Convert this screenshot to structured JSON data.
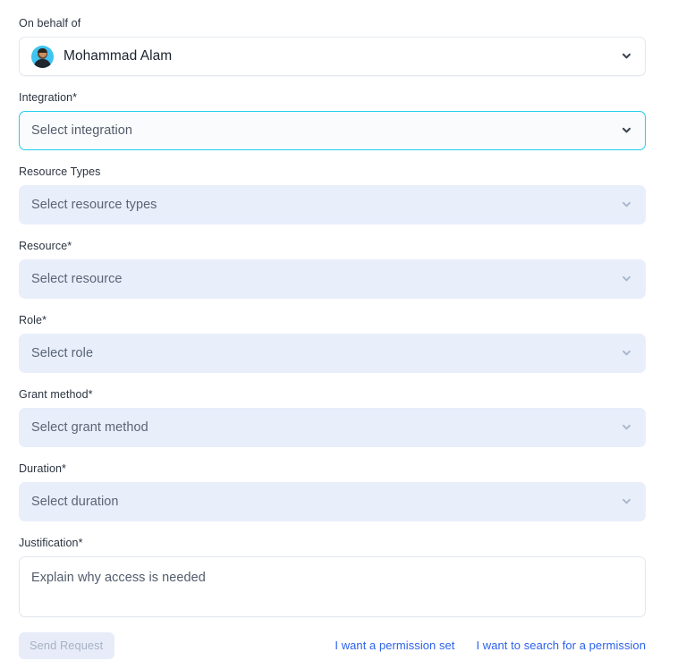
{
  "form": {
    "fields": [
      {
        "key": "on_behalf_of",
        "label": "On behalf of",
        "value": "Mohammad Alam",
        "state": "enabled",
        "has_avatar": true,
        "chevron": "chevron-down-icon"
      },
      {
        "key": "integration",
        "label": "Integration*",
        "placeholder": "Select integration",
        "state": "focused",
        "has_avatar": false,
        "chevron": "chevron-down-icon"
      },
      {
        "key": "resource_types",
        "label": "Resource Types",
        "placeholder": "Select resource types",
        "state": "disabled",
        "has_avatar": false,
        "chevron": "chevron-down-icon"
      },
      {
        "key": "resource",
        "label": "Resource*",
        "placeholder": "Select resource",
        "state": "disabled",
        "has_avatar": false,
        "chevron": "chevron-down-icon"
      },
      {
        "key": "role",
        "label": "Role*",
        "placeholder": "Select role",
        "state": "disabled",
        "has_avatar": false,
        "chevron": "chevron-down-icon"
      },
      {
        "key": "grant_method",
        "label": "Grant method*",
        "placeholder": "Select grant method",
        "state": "disabled",
        "has_avatar": false,
        "chevron": "chevron-down-icon"
      },
      {
        "key": "duration",
        "label": "Duration*",
        "placeholder": "Select duration",
        "state": "disabled",
        "has_avatar": false,
        "chevron": "chevron-down-icon"
      }
    ],
    "justification": {
      "label": "Justification*",
      "placeholder": "Explain why access is needed",
      "value": ""
    },
    "footer": {
      "submit_label": "Send Request",
      "submit_enabled": false,
      "links": [
        {
          "label": "I want a permission set"
        },
        {
          "label": "I want to search for a permission"
        }
      ]
    }
  },
  "colors": {
    "focus_border": "#22ccee",
    "disabled_field_bg": "#e8eefa",
    "link_blue": "#2c62ea",
    "disabled_btn_bg": "#e7ecf8",
    "disabled_btn_text": "#a8b2c4",
    "label_text": "#2b3440",
    "placeholder_text": "#525c6b",
    "avatar_bg": "#3fc3ef"
  }
}
